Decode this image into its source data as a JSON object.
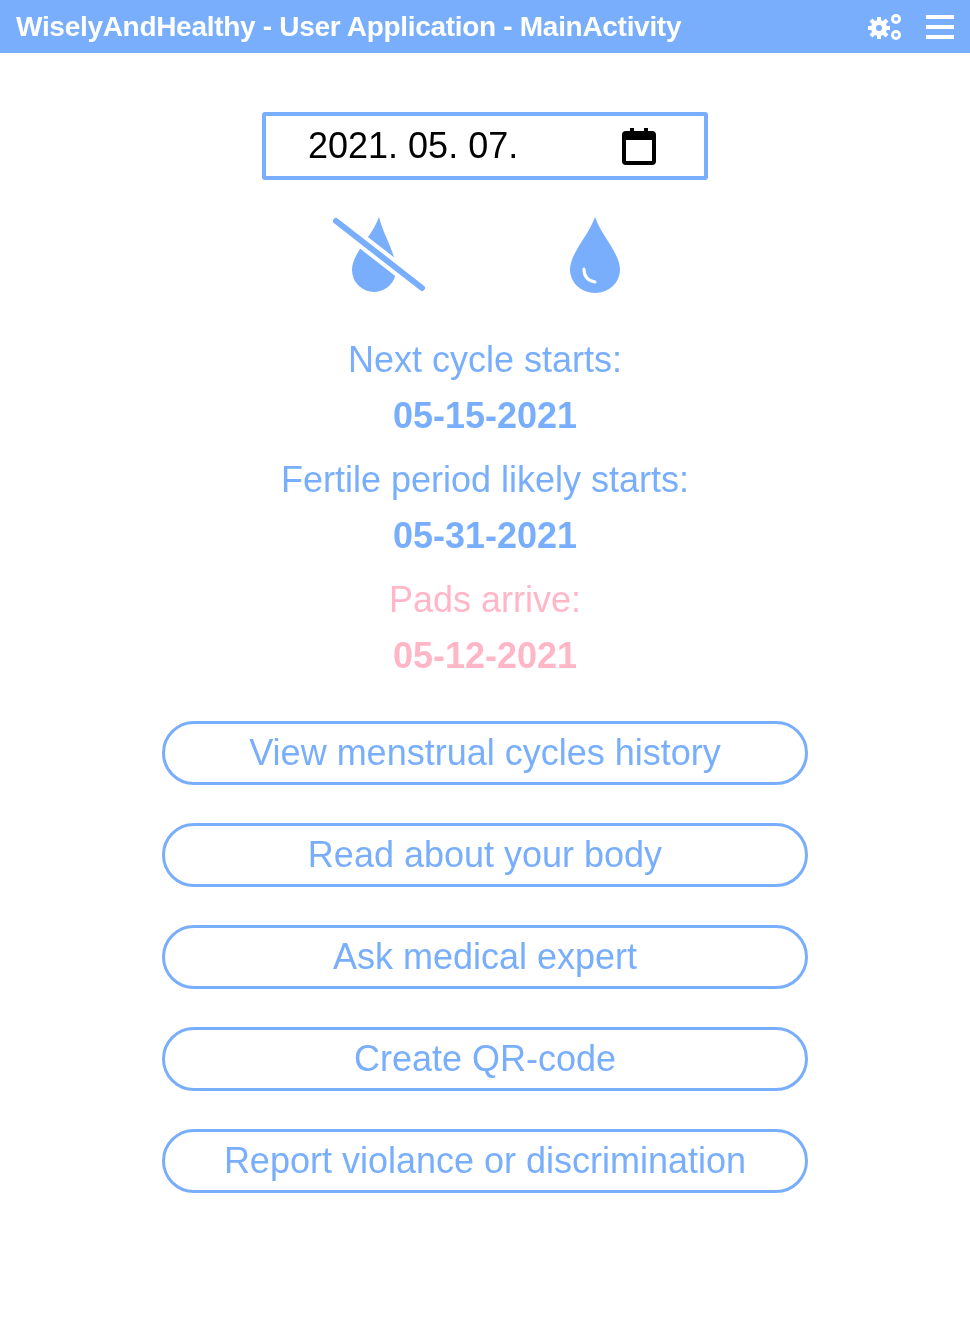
{
  "window": {
    "title": "WiselyAndHealthy - User Application - MainActivity"
  },
  "date_field": {
    "value": "2021. 05. 07."
  },
  "info": [
    {
      "label": "Next cycle starts:",
      "date": "05-15-2021",
      "color": "#78aefc"
    },
    {
      "label": "Fertile period likely starts:",
      "date": "05-31-2021",
      "color": "#78aefc"
    },
    {
      "label": "Pads arrive:",
      "date": "05-12-2021",
      "color": "#ffb6c6"
    }
  ],
  "buttons": [
    "View menstrual cycles history",
    "Read about your body",
    "Ask medical expert",
    "Create QR-code",
    "Report violance or discrimination"
  ]
}
